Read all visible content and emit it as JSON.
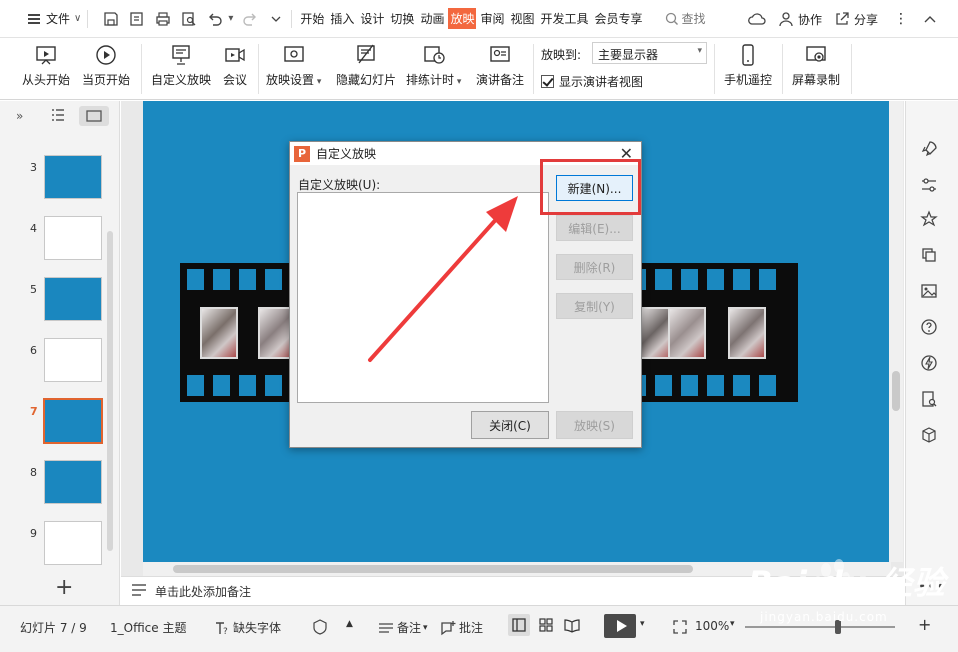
{
  "menubar": {
    "file_label": "文件",
    "tabs": [
      {
        "label": "开始",
        "active": false
      },
      {
        "label": "插入",
        "active": false
      },
      {
        "label": "设计",
        "active": false
      },
      {
        "label": "切换",
        "active": false
      },
      {
        "label": "动画",
        "active": false
      },
      {
        "label": "放映",
        "active": true
      },
      {
        "label": "审阅",
        "active": false
      },
      {
        "label": "视图",
        "active": false
      },
      {
        "label": "开发工具",
        "active": false
      },
      {
        "label": "会员专享",
        "active": false
      }
    ],
    "search_label": "查找",
    "collab_label": "协作",
    "share_label": "分享"
  },
  "ribbon": {
    "from_start": "从头开始",
    "from_current": "当页开始",
    "custom_show": "自定义放映",
    "meeting": "会议",
    "show_settings": "放映设置",
    "hide_slide": "隐藏幻灯片",
    "rehearse": "排练计时",
    "speaker_notes": "演讲备注",
    "project_to_label": "放映到:",
    "project_to_value": "主要显示器",
    "presenter_view": "显示演讲者视图",
    "phone_remote": "手机遥控",
    "screen_record": "屏幕录制"
  },
  "thumbnails": [
    {
      "num": "3",
      "style": "blue",
      "selected": false
    },
    {
      "num": "4",
      "style": "white",
      "selected": false
    },
    {
      "num": "5",
      "style": "blue",
      "selected": false
    },
    {
      "num": "6",
      "style": "white",
      "selected": false
    },
    {
      "num": "7",
      "style": "blue",
      "selected": true
    },
    {
      "num": "8",
      "style": "blue",
      "selected": false
    },
    {
      "num": "9",
      "style": "white",
      "selected": false
    }
  ],
  "dialog": {
    "title": "自定义放映",
    "list_label": "自定义放映(U):",
    "new_btn": "新建(N)...",
    "edit_btn": "编辑(E)...",
    "delete_btn": "删除(R)",
    "copy_btn": "复制(Y)",
    "close_btn": "关闭(C)",
    "show_btn": "放映(S)"
  },
  "notes": {
    "placeholder": "单击此处添加备注"
  },
  "status": {
    "slide_counter": "幻灯片 7 / 9",
    "theme": "1_Office 主题",
    "missing_font": "缺失字体",
    "notes": "备注",
    "comments": "批注",
    "zoom": "100%",
    "zoom_level_percent": 100
  },
  "watermark": {
    "text": "Bai du 经验",
    "sub": "jingyan.baidu.com"
  },
  "colors": {
    "accent": "#f3683f",
    "slide_bg": "#1b89c0",
    "highlight": "#e23b3b"
  }
}
